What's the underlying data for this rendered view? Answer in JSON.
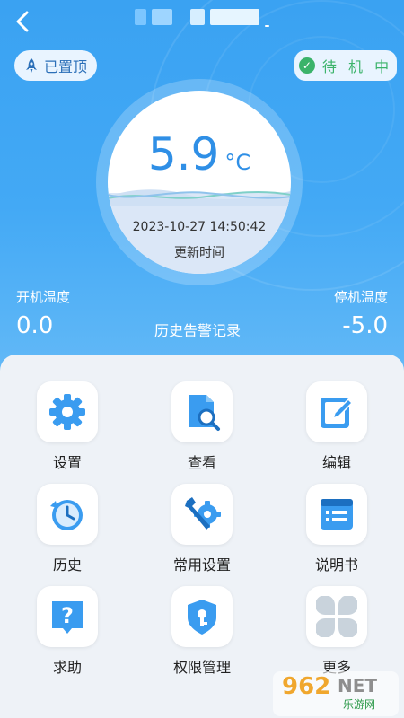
{
  "header": {
    "back_icon": "chevron-left-icon"
  },
  "badges": {
    "pinned_label": "已置顶",
    "status_label": "待 机 中",
    "status_color": "#3bb36a"
  },
  "gauge": {
    "temperature": "5.9",
    "unit": "°C",
    "updated_time": "2023-10-27 14:50:42",
    "updated_label": "更新时间"
  },
  "thresholds": {
    "on_label": "开机温度",
    "on_value": "0.0",
    "off_label": "停机温度",
    "off_value": "-5.0",
    "history_link": "历史告警记录"
  },
  "menu": {
    "items": [
      {
        "label": "设置",
        "icon": "gear-icon"
      },
      {
        "label": "查看",
        "icon": "document-search-icon"
      },
      {
        "label": "编辑",
        "icon": "edit-icon"
      },
      {
        "label": "历史",
        "icon": "clock-icon"
      },
      {
        "label": "常用设置",
        "icon": "tools-icon"
      },
      {
        "label": "说明书",
        "icon": "manual-icon"
      },
      {
        "label": "求助",
        "icon": "help-icon"
      },
      {
        "label": "权限管理",
        "icon": "shield-key-icon"
      },
      {
        "label": "更多",
        "icon": "more-grid-icon"
      }
    ]
  },
  "watermark": {
    "brand": "962",
    "brand_suffix": "NET",
    "sub": "乐游网"
  },
  "colors": {
    "accent": "#3a9cf0",
    "hero_top": "#3aa2f2"
  }
}
